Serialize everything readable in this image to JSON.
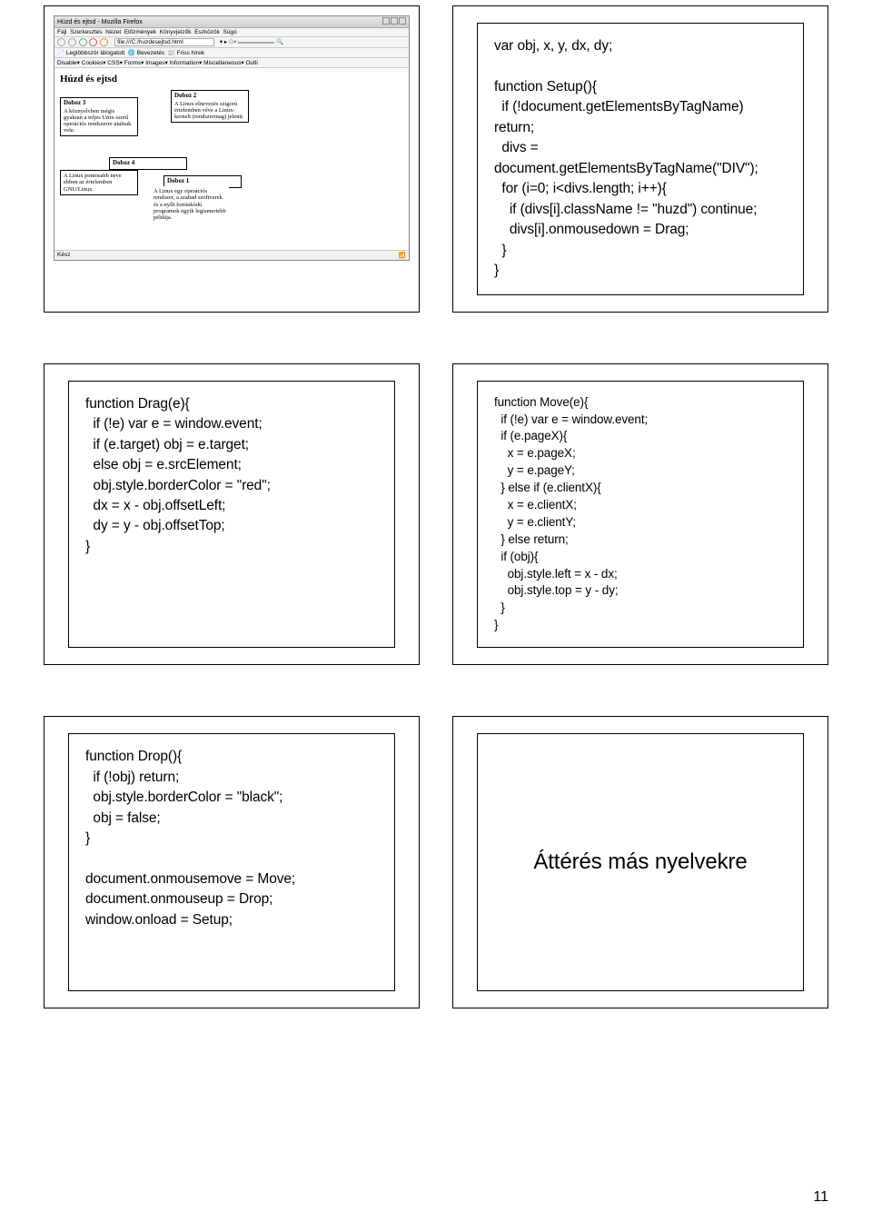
{
  "page_number": "11",
  "row1": {
    "screenshot": {
      "window_title": "Húzd és ejtsd - Mozilla Firefox",
      "menu": [
        "Fájl",
        "Szerkesztés",
        "Nézet",
        "Előzmények",
        "Könyvjelzők",
        "Eszközök",
        "Súgó"
      ],
      "url": "file:///C:/huzdesejtsd.html",
      "search_placeholder": "Google",
      "tab1": "Legtöbbször látogatott",
      "tab2": "Bevezetés",
      "tab3": "Friss hírek",
      "devbar": "Disable▾   Cookies▾   CSS▾   Forms▾   Images▾   Information▾   Miscellaneous▾   Outli",
      "heading": "Húzd és ejtsd",
      "status_left": "Kész",
      "box3_title": "Doboz 3",
      "box3_text": "A köznyelvben mégis gyakran a teljes Unix-szerű operációs rendszerre utalnak vele.",
      "box4_title": "Doboz 4",
      "box4_text": "A Linux pontosabb neve ebben az értelemben GNU/Linux.",
      "box2_title": "Doboz 2",
      "box2_text": "A Linux elnevezés szigorú értelemben véve a Linux-kernelt (rendszermag) jelenti",
      "box1_title": "Doboz 1",
      "box1_text": "A Linux egy operációs rendszer, a szabad szoftverek és a nyílt forráskódú programok egyik legismertebb példája."
    },
    "code_setup": "var obj, x, y, dx, dy;\n\nfunction Setup(){\n  if (!document.getElementsByTagName) return;\n  divs = document.getElementsByTagName(\"DIV\");\n  for (i=0; i<divs.length; i++){\n    if (divs[i].className != \"huzd\") continue;\n    divs[i].onmousedown = Drag;\n  }\n}"
  },
  "row2": {
    "code_drag": "function Drag(e){\n  if (!e) var e = window.event;\n  if (e.target) obj = e.target;\n  else obj = e.srcElement;\n  obj.style.borderColor = \"red\";\n  dx = x - obj.offsetLeft;\n  dy = y - obj.offsetTop;\n}",
    "code_move": "function Move(e){\n  if (!e) var e = window.event;\n  if (e.pageX){\n    x = e.pageX;\n    y = e.pageY;\n  } else if (e.clientX){\n    x = e.clientX;\n    y = e.clientY;\n  } else return;\n  if (obj){\n    obj.style.left = x - dx;\n    obj.style.top = y - dy;\n  }\n}"
  },
  "row3": {
    "code_drop": "function Drop(){\n  if (!obj) return;\n  obj.style.borderColor = \"black\";\n  obj = false;\n}\n\ndocument.onmousemove = Move;\ndocument.onmouseup = Drop;\nwindow.onload = Setup;",
    "title": "Áttérés más nyelvekre"
  }
}
